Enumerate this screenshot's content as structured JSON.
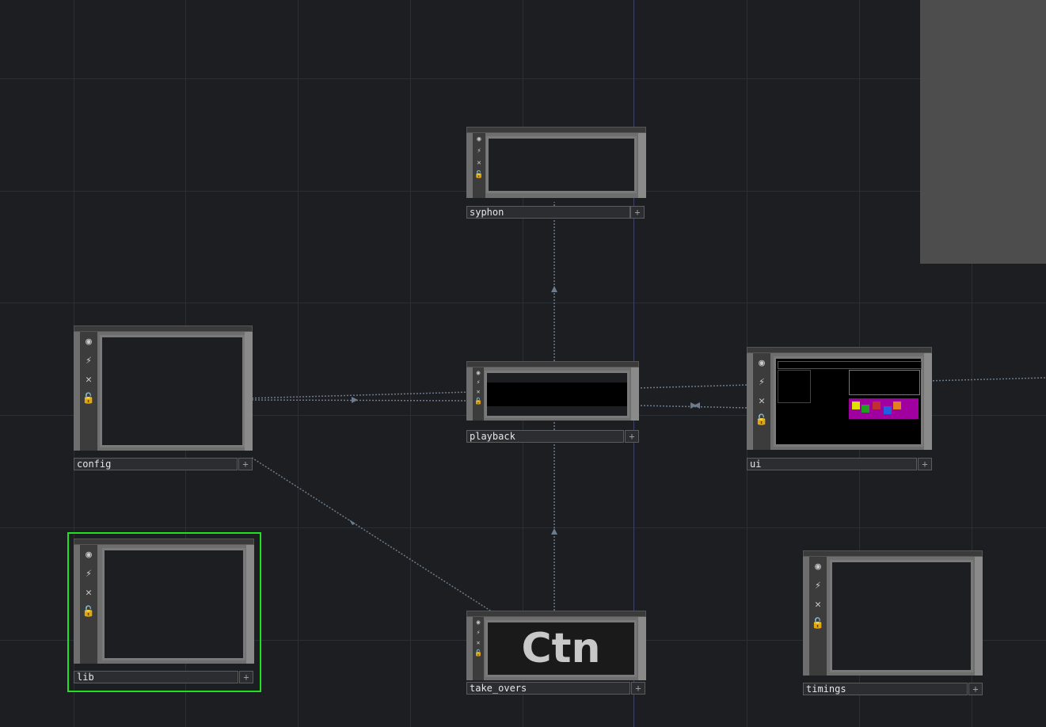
{
  "nodes": {
    "syphon": {
      "label": "syphon"
    },
    "config": {
      "label": "config"
    },
    "playback": {
      "label": "playback"
    },
    "ui": {
      "label": "ui"
    },
    "lib": {
      "label": "lib"
    },
    "take_overs": {
      "label": "take_overs",
      "viewer_text": "Ctn"
    },
    "timings": {
      "label": "timings"
    }
  },
  "icons": {
    "viewer": "◉",
    "cook": "⚡",
    "bypass": "✕",
    "lock": "🔓"
  },
  "plus_glyph": "+",
  "colors": {
    "background": "#1c1e22",
    "grid": "#2a2e35",
    "selected": "#20e020",
    "wire": "#6c7c8c"
  }
}
